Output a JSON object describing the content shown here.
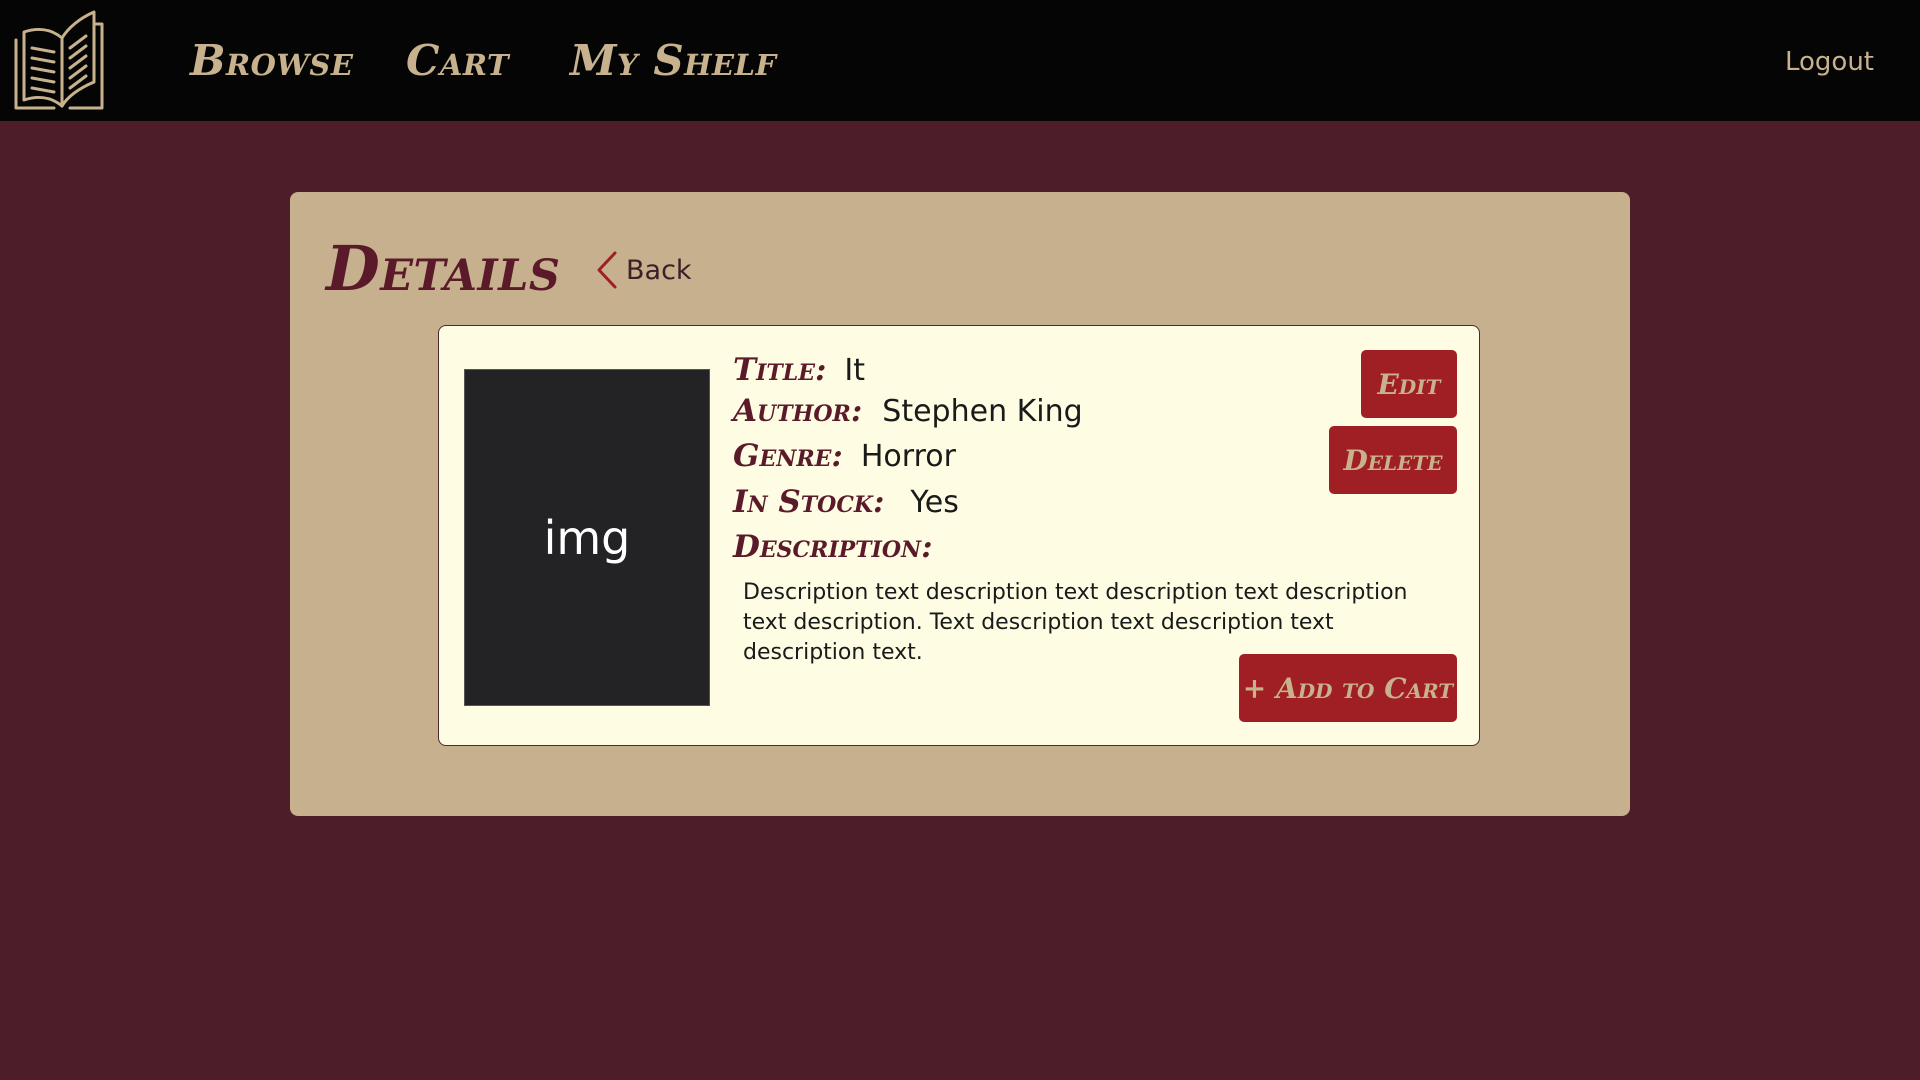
{
  "nav": {
    "links": [
      "Browse",
      "Cart",
      "My Shelf"
    ],
    "logout": "Logout",
    "logo_icon": "open-book-icon"
  },
  "page": {
    "title": "Details",
    "back_label": "Back"
  },
  "book": {
    "image_placeholder": "img",
    "title_label": "Title:",
    "title": "It",
    "author_label": "Author:",
    "author": "Stephen King",
    "genre_label": "Genre:",
    "genre": "Horror",
    "stock_label": "In Stock:",
    "in_stock": "Yes",
    "description_label": "Description:",
    "description": "Description text description text description text description text description. Text description text description text description text."
  },
  "actions": {
    "edit": "Edit",
    "delete": "Delete",
    "add_to_cart": "+ Add to Cart"
  },
  "colors": {
    "background": "#4d1e2a",
    "navbar": "#050505",
    "panel": "#c6b08d",
    "card": "#fefde4",
    "accent": "#a01f25",
    "heading": "#5a1a2a",
    "nav_text": "#c8b28d"
  }
}
